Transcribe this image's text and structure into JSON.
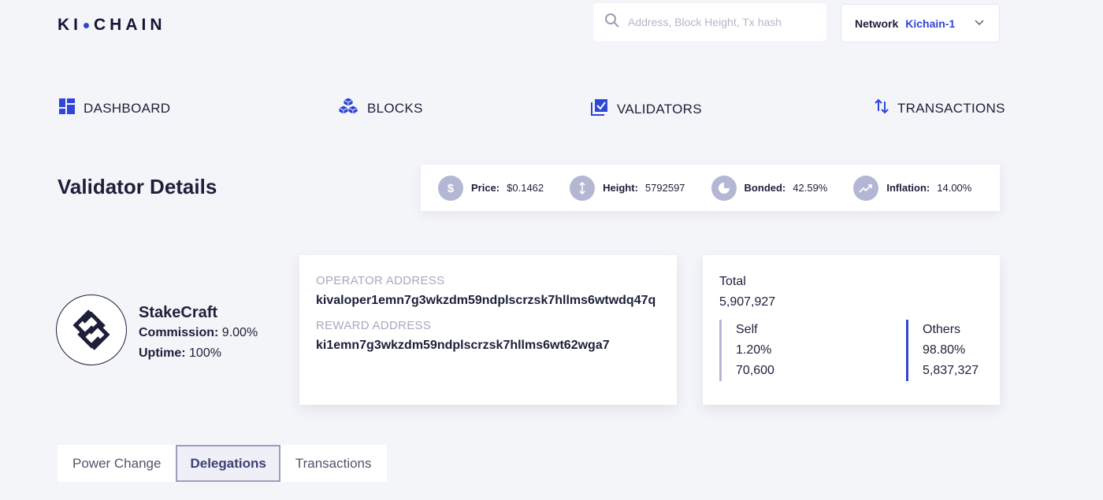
{
  "header": {
    "logo_left": "KI",
    "logo_right": "CHAIN",
    "search_placeholder": "Address, Block Height, Tx hash",
    "network_label": "Network",
    "network_value": "Kichain-1"
  },
  "nav": {
    "dashboard": "DASHBOARD",
    "blocks": "BLOCKS",
    "validators": "VALIDATORS",
    "transactions": "TRANSACTIONS"
  },
  "page_title": "Validator Details",
  "stats": {
    "price_label": "Price:",
    "price_value": "$0.1462",
    "height_label": "Height:",
    "height_value": "5792597",
    "bonded_label": "Bonded:",
    "bonded_value": "42.59%",
    "inflation_label": "Inflation:",
    "inflation_value": "14.00%"
  },
  "validator": {
    "name": "StakeCraft",
    "commission_label": "Commission:",
    "commission_value": "9.00%",
    "uptime_label": "Uptime:",
    "uptime_value": "100%"
  },
  "addresses": {
    "operator_label": "OPERATOR ADDRESS",
    "operator_value": "kivaloper1emn7g3wkzdm59ndplscrzsk7hllms6wtwdq47q",
    "reward_label": "REWARD ADDRESS",
    "reward_value": "ki1emn7g3wkzdm59ndplscrzsk7hllms6wt62wga7"
  },
  "voting_power": {
    "total_label": "Total",
    "total_value": "5,907,927",
    "self_label": "Self",
    "self_percent": "1.20%",
    "self_value": "70,600",
    "others_label": "Others",
    "others_percent": "98.80%",
    "others_value": "5,837,327"
  },
  "tabs": {
    "power_change": "Power Change",
    "delegations": "Delegations",
    "transactions": "Transactions"
  },
  "colors": {
    "accent": "#2f46d6",
    "muted_icon": "#b4b7d4",
    "background": "#f4f5f9"
  }
}
